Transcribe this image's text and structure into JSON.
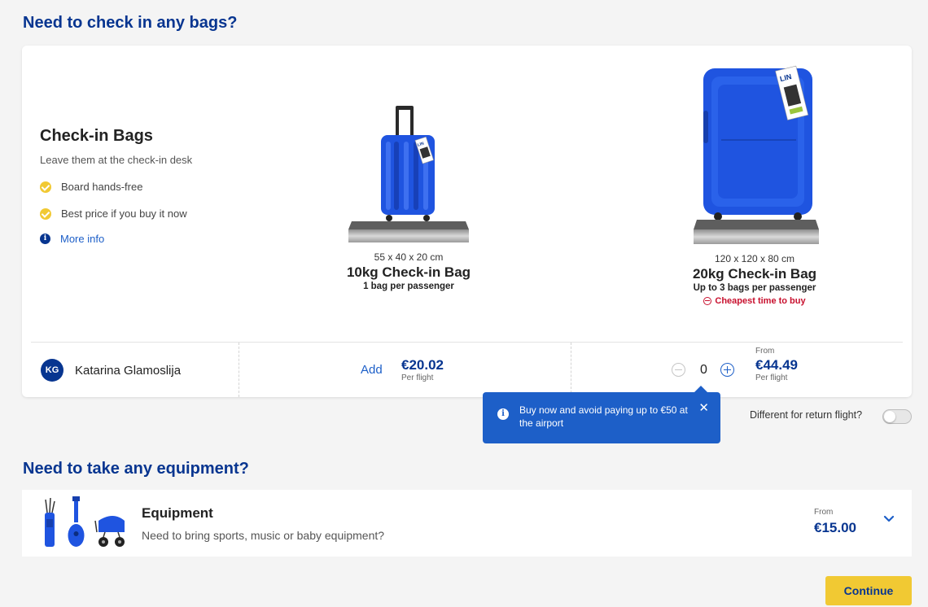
{
  "bags_section": {
    "title": "Need to check in any bags?",
    "card": {
      "title": "Check-in Bags",
      "subtitle": "Leave them at the check-in desk",
      "features": [
        "Board hands-free",
        "Best price if you buy it now"
      ],
      "more_info": "More info"
    },
    "bag_small": {
      "dims": "55 x 40 x 20 cm",
      "name": "10kg Check-in Bag",
      "sub": "1 bag per passenger",
      "tag": "LIN"
    },
    "bag_large": {
      "dims": "120 x 120 x 80 cm",
      "name": "20kg Check-in Bag",
      "sub": "Up to 3 bags per passenger",
      "cheapest": "Cheapest time to buy",
      "tag": "LIN"
    },
    "passenger": {
      "initials": "KG",
      "name": "Katarina Glamoslija",
      "small_add": "Add",
      "small_price": "€20.02",
      "small_per": "Per flight",
      "large_count": "0",
      "large_from": "From",
      "large_price": "€44.49",
      "large_per": "Per flight"
    },
    "tooltip": {
      "text": "Buy now and avoid paying up to €50 at the airport",
      "close": "✕"
    },
    "return_toggle": {
      "label": "Different for return flight?",
      "on": false
    }
  },
  "equipment_section": {
    "title": "Need to take any equipment?",
    "card": {
      "title": "Equipment",
      "subtitle": "Need to bring sports, music or baby equipment?",
      "from": "From",
      "price": "€15.00"
    }
  },
  "continue_label": "Continue",
  "colors": {
    "brand_blue": "#073590",
    "link_blue": "#1d5fc8",
    "yellow": "#f1c933",
    "red": "#c8102e",
    "suitcase": "#1f54e0"
  }
}
